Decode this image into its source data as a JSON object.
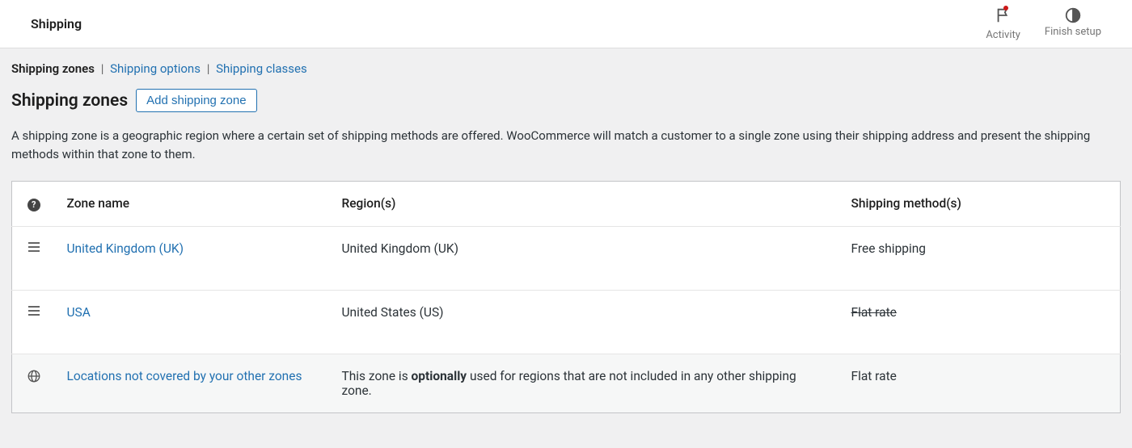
{
  "topbar": {
    "title": "Shipping",
    "actions": {
      "activity": "Activity",
      "finish_setup": "Finish setup"
    }
  },
  "subtabs": {
    "zones": "Shipping zones",
    "options": "Shipping options",
    "classes": "Shipping classes"
  },
  "heading": "Shipping zones",
  "add_button": "Add shipping zone",
  "description": "A shipping zone is a geographic region where a certain set of shipping methods are offered. WooCommerce will match a customer to a single zone using their shipping address and present the shipping methods within that zone to them.",
  "table": {
    "headers": {
      "name": "Zone name",
      "region": "Region(s)",
      "method": "Shipping method(s)"
    },
    "rows": [
      {
        "name": "United Kingdom (UK)",
        "region": "United Kingdom (UK)",
        "method": "Free shipping",
        "method_strike": false
      },
      {
        "name": "USA",
        "region": "United States (US)",
        "method": "Flat rate",
        "method_strike": true
      }
    ],
    "fallback": {
      "name": "Locations not covered by your other zones",
      "region_pre": "This zone is ",
      "region_bold": "optionally",
      "region_post": " used for regions that are not included in any other shipping zone.",
      "method": "Flat rate"
    }
  }
}
